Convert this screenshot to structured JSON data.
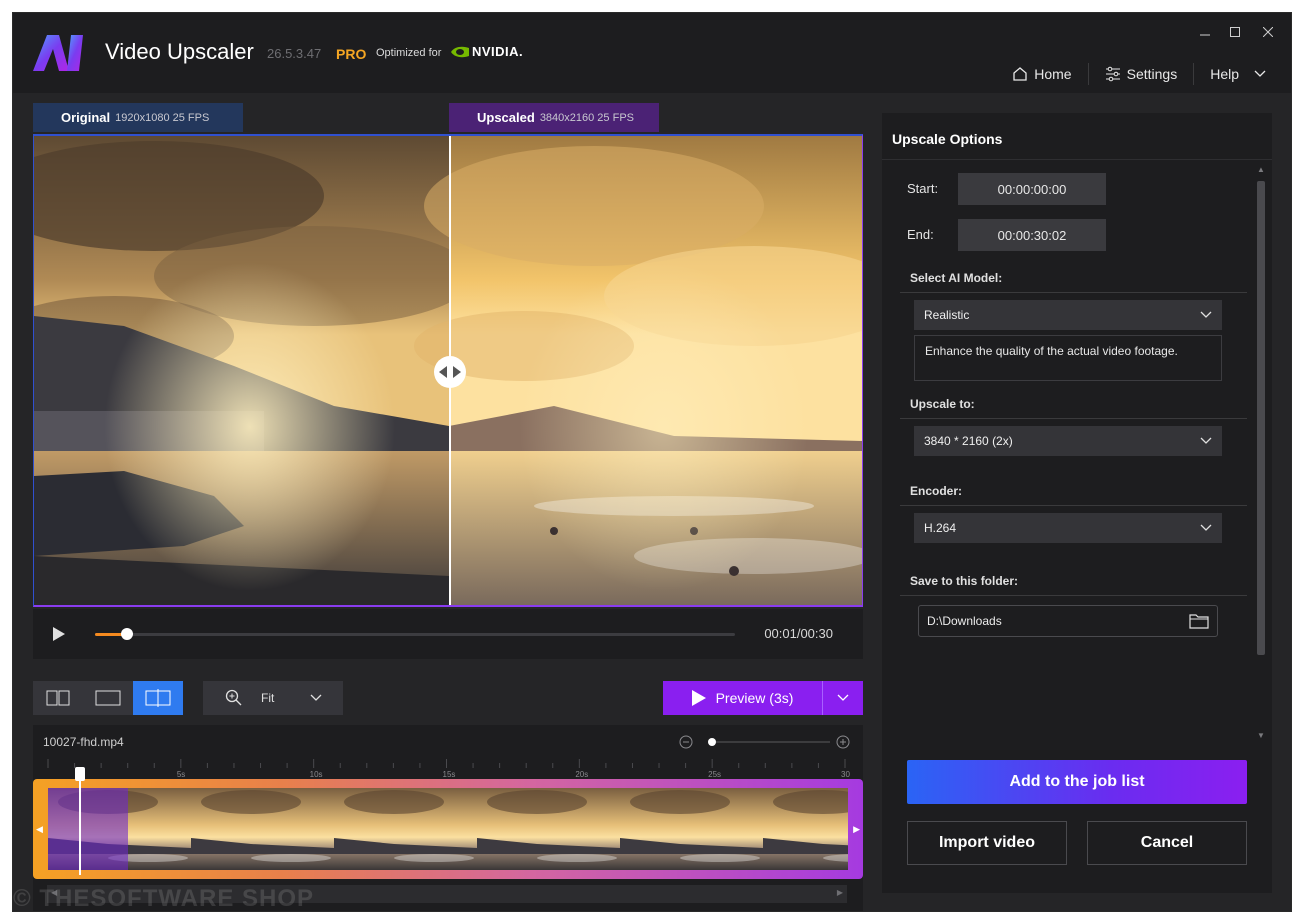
{
  "window": {
    "app_title": "Video Upscaler",
    "version": "26.5.3.47",
    "pro_badge": "PRO",
    "optimized_for": "Optimized for",
    "nvidia_label": "NVIDIA.",
    "logo_text": "AI"
  },
  "nav": {
    "home": "Home",
    "settings": "Settings",
    "help": "Help"
  },
  "tabs": {
    "original": {
      "label": "Original",
      "resolution": "1920x1080 25 FPS"
    },
    "upscaled": {
      "label": "Upscaled",
      "resolution": "3840x2160 25 FPS"
    }
  },
  "player": {
    "timecode": "00:01/00:30",
    "progress": 0.05
  },
  "view_controls": {
    "zoom_value": "Fit",
    "preview_label": "Preview (3s)"
  },
  "timeline": {
    "file_name": "10027-fhd.mp4",
    "ticks": [
      "5s",
      "10s",
      "15s",
      "20s",
      "25s",
      "30"
    ],
    "zoom_level": 0.0
  },
  "options": {
    "title": "Upscale Options",
    "start_label": "Start:",
    "start_value": "00:00:00:00",
    "end_label": "End:",
    "end_value": "00:00:30:02",
    "model_section": "Select AI Model:",
    "model_value": "Realistic",
    "model_description": "Enhance the quality of the actual video footage.",
    "upscale_section": "Upscale to:",
    "upscale_value": "3840 * 2160 (2x)",
    "encoder_section": "Encoder:",
    "encoder_value": "H.264",
    "folder_section": "Save to this folder:",
    "folder_value": "D:\\Downloads",
    "add_job": "Add to the job list",
    "import": "Import video",
    "cancel": "Cancel"
  },
  "watermark": "© THESOFTWARE SHOP",
  "colors": {
    "accent_purple": "#8a1ff0",
    "accent_blue": "#2f7bf0",
    "pro_orange": "#f5a623",
    "seek_orange": "#f58a1f",
    "nvidia_green": "#76b900"
  }
}
